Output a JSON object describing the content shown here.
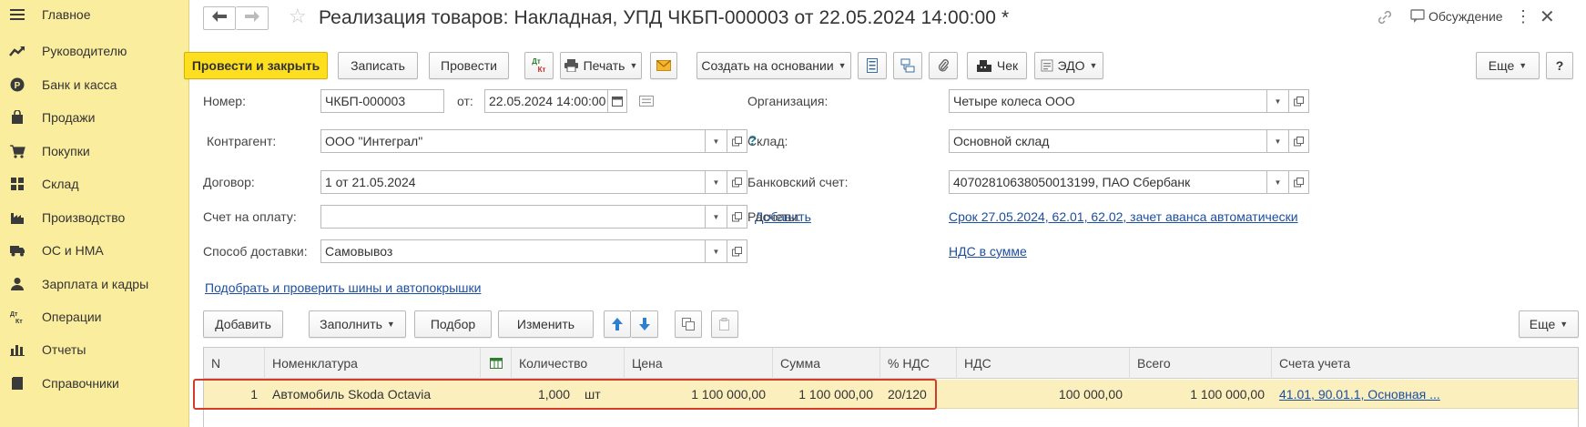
{
  "sidebar": {
    "items": [
      {
        "label": "Главное",
        "icon": "menu-icon"
      },
      {
        "label": "Руководителю",
        "icon": "trend-icon"
      },
      {
        "label": "Банк и касса",
        "icon": "coin-icon"
      },
      {
        "label": "Продажи",
        "icon": "bag-icon"
      },
      {
        "label": "Покупки",
        "icon": "cart-icon"
      },
      {
        "label": "Склад",
        "icon": "warehouse-icon"
      },
      {
        "label": "Производство",
        "icon": "factory-icon"
      },
      {
        "label": "ОС и НМА",
        "icon": "truck-icon"
      },
      {
        "label": "Зарплата и кадры",
        "icon": "person-icon"
      },
      {
        "label": "Операции",
        "icon": "dt-kt-icon"
      },
      {
        "label": "Отчеты",
        "icon": "bar-chart-icon"
      },
      {
        "label": "Справочники",
        "icon": "book-icon"
      }
    ]
  },
  "header": {
    "title": "Реализация товаров: Накладная, УПД ЧКБП-000003 от 22.05.2024 14:00:00 *",
    "discussion": "Обсуждение"
  },
  "toolbar": {
    "post_close": "Провести и закрыть",
    "save": "Записать",
    "post": "Провести",
    "dtkt_top": "Дт",
    "dtkt_bottom": "Кт",
    "print": "Печать",
    "create_based": "Создать на основании",
    "check": "Чек",
    "edo": "ЭДО",
    "more": "Еще",
    "help": "?"
  },
  "form": {
    "number_label": "Номер:",
    "number_value": "ЧКБП-000003",
    "date_label": "от:",
    "date_value": "22.05.2024 14:00:00",
    "org_label": "Организация:",
    "org_value": "Четыре колеса ООО",
    "counterparty_label": "Контрагент:",
    "counterparty_value": "ООО \"Интеграл\"",
    "question": "?",
    "warehouse_label": "Склад:",
    "warehouse_value": "Основной склад",
    "contract_label": "Договор:",
    "contract_value": "1 от 21.05.2024",
    "bank_label": "Банковский счет:",
    "bank_value": "40702810638050013199, ПАО Сбербанк",
    "invoice_label": "Счет на оплату:",
    "invoice_value": "",
    "add_link": "Добавить",
    "settlements_label": "Расчеты:",
    "settlements_link": "Срок 27.05.2024, 62.01, 62.02, зачет аванса автоматически",
    "delivery_label": "Способ доставки:",
    "delivery_value": "Самовывоз",
    "vat_link": "НДС в сумме",
    "tires_link": "Подобрать и проверить шины и автопокрышки"
  },
  "table_toolbar": {
    "add": "Добавить",
    "fill": "Заполнить",
    "select": "Подбор",
    "change": "Изменить",
    "more": "Еще"
  },
  "table": {
    "headers": [
      "N",
      "Номенклатура",
      "Количество",
      "Цена",
      "Сумма",
      "% НДС",
      "НДС",
      "Всего",
      "Счета учета"
    ],
    "rows": [
      {
        "n": "1",
        "item": "Автомобиль Skoda Octavia",
        "qty": "1,000",
        "unit": "шт",
        "price": "1 100 000,00",
        "sum": "1 100 000,00",
        "vat_rate": "20/120",
        "vat": "100 000,00",
        "total": "1 100 000,00",
        "accounts": "41.01, 90.01.1, Основная ..."
      }
    ]
  },
  "colors": {
    "sidebar_bg": "#fbed9e",
    "primary_button": "#fedf1f",
    "link": "#1d4fa0",
    "row_selected": "#fbefbe",
    "highlight_border": "#d43c2a"
  }
}
